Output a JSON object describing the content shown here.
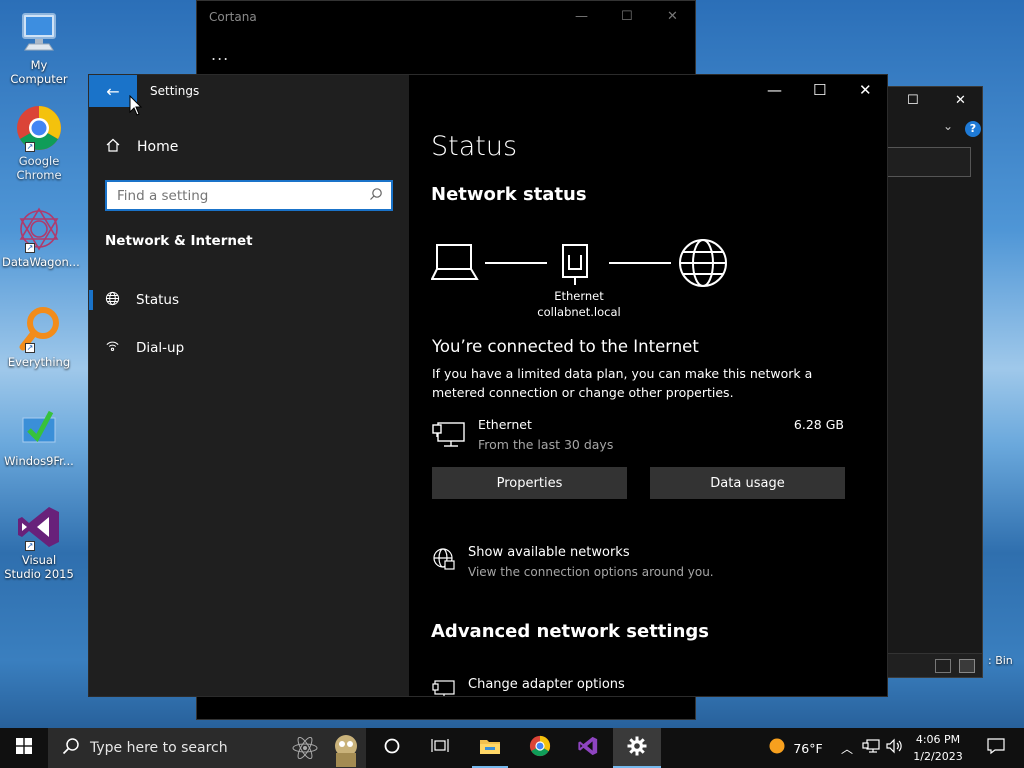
{
  "desktop": {
    "icons": [
      {
        "label": "My Computer"
      },
      {
        "label": "Google Chrome"
      },
      {
        "label": "DataWagon..."
      },
      {
        "label": "Everything"
      },
      {
        "label": "Windos9Fr..."
      },
      {
        "label": "Visual Studio 2015"
      }
    ],
    "recycle_bin_label": "Bin"
  },
  "cortana": {
    "title": "Cortana",
    "more": "..."
  },
  "settings": {
    "app_title": "Settings",
    "sidebar": {
      "home_label": "Home",
      "search_placeholder": "Find a setting",
      "section_heading": "Network & Internet",
      "items": [
        {
          "label": "Status",
          "icon": "globe-icon",
          "selected": true
        },
        {
          "label": "Dial-up",
          "icon": "dialup-icon",
          "selected": false
        }
      ]
    },
    "content": {
      "page_title": "Status",
      "network_status_heading": "Network status",
      "diagram": {
        "adapter_label": "Ethernet",
        "domain_label": "collabnet.local"
      },
      "connected_heading": "You’re connected to the Internet",
      "connected_desc": "If you have a limited data plan, you can make this network a metered connection or change other properties.",
      "ethernet": {
        "name": "Ethernet",
        "sub": "From the last 30 days",
        "usage": "6.28 GB"
      },
      "buttons": {
        "properties": "Properties",
        "data_usage": "Data usage"
      },
      "available_networks": {
        "title": "Show available networks",
        "subtitle": "View the connection options around you."
      },
      "advanced_heading": "Advanced network settings",
      "change_adapter": "Change adapter options"
    }
  },
  "taskbar": {
    "search_placeholder": "Type here to search",
    "weather": "76°F",
    "time": "4:06 PM",
    "date": "1/2/2023"
  },
  "colors": {
    "accent": "#1a73c9",
    "sidebar_bg": "#1f1f1f",
    "content_bg": "#000000",
    "button_bg": "#333333",
    "secondary_text": "#a6a6a6"
  }
}
